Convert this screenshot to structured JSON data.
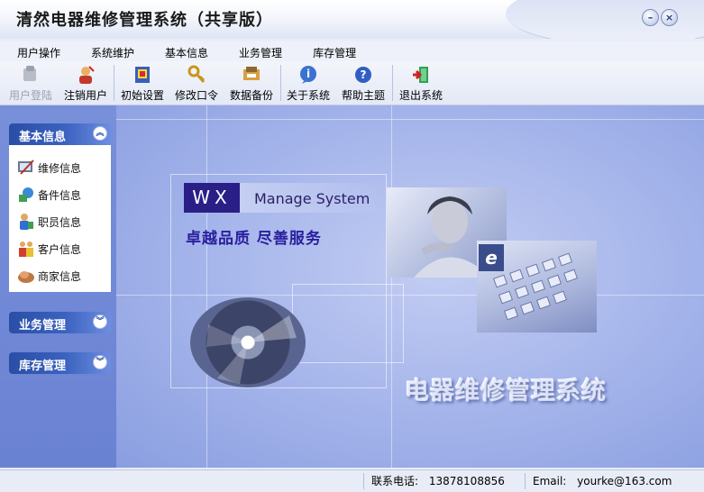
{
  "window": {
    "title": "清然电器维修管理系统（共享版）",
    "buttons": {
      "minimize": "–",
      "close": "×"
    }
  },
  "menu": [
    "用户操作",
    "系统维护",
    "基本信息",
    "业务管理",
    "库存管理"
  ],
  "toolbar": [
    {
      "label": "用户登陆",
      "icon": "user-login-icon",
      "enabled": false
    },
    {
      "label": "注销用户",
      "icon": "logout-user-icon",
      "enabled": true
    },
    {
      "label": "初始设置",
      "icon": "init-settings-icon",
      "enabled": true
    },
    {
      "label": "修改口令",
      "icon": "key-icon",
      "enabled": true
    },
    {
      "label": "数据备份",
      "icon": "backup-icon",
      "enabled": true
    },
    {
      "label": "关于系统",
      "icon": "about-icon",
      "enabled": true
    },
    {
      "label": "帮助主题",
      "icon": "help-icon",
      "enabled": true
    },
    {
      "label": "退出系统",
      "icon": "exit-icon",
      "enabled": true
    }
  ],
  "sidebar": {
    "groups": [
      {
        "title": "基本信息",
        "expanded": true,
        "items": [
          {
            "label": "维修信息",
            "icon": "repair-info-icon"
          },
          {
            "label": "备件信息",
            "icon": "spare-parts-icon"
          },
          {
            "label": "职员信息",
            "icon": "staff-icon"
          },
          {
            "label": "客户信息",
            "icon": "customer-icon"
          },
          {
            "label": "商家信息",
            "icon": "merchant-icon"
          }
        ]
      },
      {
        "title": "业务管理",
        "expanded": false,
        "items": []
      },
      {
        "title": "库存管理",
        "expanded": false,
        "items": []
      }
    ]
  },
  "banner": {
    "wx": "WX",
    "tagline": "Manage  System",
    "slogan": "卓越品质 尽善服务",
    "watermark": "电器维修管理系统",
    "e_logo": "e"
  },
  "status": {
    "phone_label": "联系电话:",
    "phone": "13878108856",
    "email_label": "Email:",
    "email": "yourke@163.com"
  },
  "colors": {
    "sidebar_bg": "#7890da",
    "group_header": "#2a4ea6",
    "main_bg": "#a3b3ea",
    "slogan": "#2a1f9e"
  }
}
